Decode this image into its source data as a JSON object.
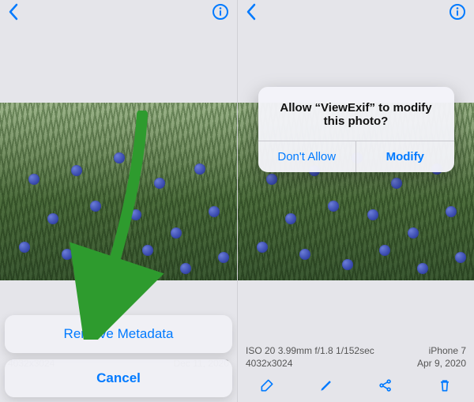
{
  "nav": {
    "back_label": "Back",
    "info_label": "Info"
  },
  "left": {
    "action_sheet": {
      "remove_label": "Remove Metadata",
      "cancel_label": "Cancel"
    },
    "meta": {
      "dimensions": "4032x3024",
      "date": "Dec 11, 2020"
    }
  },
  "right": {
    "alert": {
      "message": "Allow “ViewExif” to modify this photo?",
      "deny_label": "Don't Allow",
      "allow_label": "Modify"
    },
    "meta": {
      "exif_line": "ISO 20  3.99mm  f/1.8  1/152sec",
      "dimensions": "4032x3024",
      "device": "iPhone 7",
      "date": "Apr 9, 2020"
    }
  },
  "toolbar": {
    "erase_label": "Erase",
    "edit_label": "Edit",
    "share_label": "Share",
    "trash_label": "Delete"
  },
  "annotation": {
    "arrow_color": "#2e9b2e"
  }
}
